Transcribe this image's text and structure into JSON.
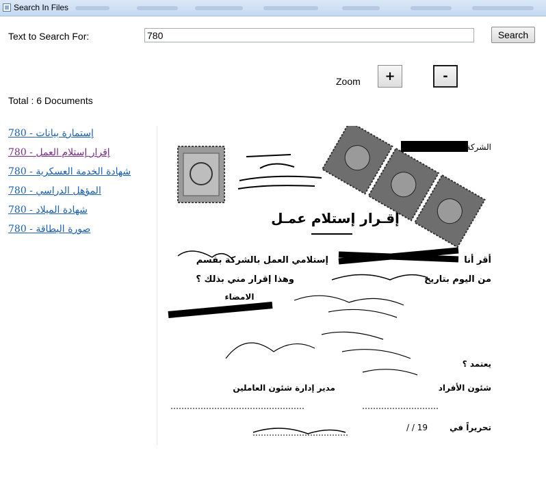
{
  "window": {
    "title": "Search In Files"
  },
  "search": {
    "label": "Text to Search For:",
    "value": "780",
    "button": "Search"
  },
  "zoom": {
    "label": "Zoom",
    "plus": "+",
    "minus": "-"
  },
  "results": {
    "total_prefix": "Total : ",
    "count": "6",
    "total_suffix": " Documents",
    "items": [
      {
        "label": "780 - إستمارة بيانات",
        "visited": false
      },
      {
        "label": "780 - إقرار إستلام العمل",
        "visited": true
      },
      {
        "label": "780 - شهادة الخدمة العسكرية",
        "visited": false
      },
      {
        "label": "780 - المؤهل الدراسي",
        "visited": false
      },
      {
        "label": "780 - شهادة الميلاد",
        "visited": false
      },
      {
        "label": "780 - صورة البطاقة",
        "visited": false
      }
    ]
  },
  "document": {
    "company_label": "الشركة",
    "heading": "إقـرار إستلام عمـل",
    "line1_prefix": "أقر أنا",
    "line1_rest": "إستلامي العمل بالشركة بقسم",
    "line2_prefix": "من اليوم بتاريخ",
    "line2_rest": "وهذا إقرار مني بذلك ؟",
    "signature_label": "الامضاء",
    "approved": "يعتمد ؟",
    "personnel": "شئون الأفراد",
    "hr_manager": "مدير إدارة شئون العاملين",
    "dated": "تحريراً في",
    "date_blank": "/      /      19"
  }
}
